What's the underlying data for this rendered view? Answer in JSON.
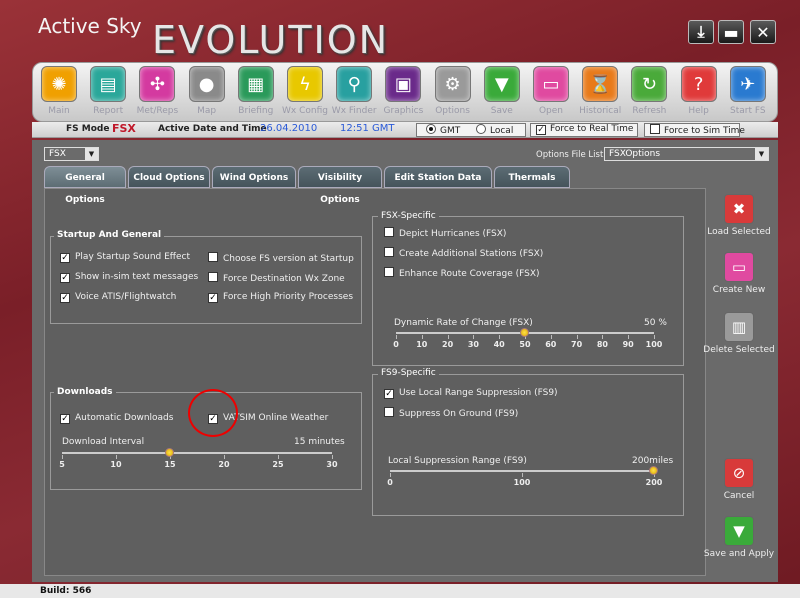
{
  "app": {
    "title_small": "Active Sky",
    "title_big": "EVOLUTION"
  },
  "window_buttons": [
    {
      "glyph": "⤓",
      "name": "download-icon"
    },
    {
      "glyph": "▬",
      "name": "minimize-icon"
    },
    {
      "glyph": "✕",
      "name": "close-icon"
    }
  ],
  "toolbar": [
    {
      "label": "Main",
      "color": "#f0a000",
      "glyph": "✺"
    },
    {
      "label": "Report",
      "color": "#2aa79a",
      "glyph": "▤"
    },
    {
      "label": "Met/Reps",
      "color": "#d43aa0",
      "glyph": "✣"
    },
    {
      "label": "Map",
      "color": "#8a8a8a",
      "glyph": "●"
    },
    {
      "label": "Briefing",
      "color": "#2a9a5a",
      "glyph": "▦"
    },
    {
      "label": "Wx Config",
      "color": "#e8c800",
      "glyph": "ϟ"
    },
    {
      "label": "Wx Finder",
      "color": "#28a0a0",
      "glyph": "⚲"
    },
    {
      "label": "Graphics",
      "color": "#6a2a8a",
      "glyph": "▣"
    },
    {
      "label": "Options",
      "color": "#9a9a9a",
      "glyph": "⚙"
    },
    {
      "label": "Save",
      "color": "#3aaa3a",
      "glyph": "▼"
    },
    {
      "label": "Open",
      "color": "#e04aa0",
      "glyph": "▭"
    },
    {
      "label": "Historical",
      "color": "#e87a1a",
      "glyph": "⌛"
    },
    {
      "label": "Refresh",
      "color": "#4aaa3a",
      "glyph": "↻"
    },
    {
      "label": "Help",
      "color": "#e03a3a",
      "glyph": "?"
    },
    {
      "label": "Start FS",
      "color": "#2a7ad0",
      "glyph": "✈"
    }
  ],
  "modebar": {
    "fs_mode_label": "FS Mode",
    "fs_mode_value": "FSX",
    "date_label": "Active Date and Time",
    "date_value": "26.04.2010",
    "time_value": "12:51 GMT",
    "gmt": "GMT",
    "local": "Local",
    "force_real": "Force to Real Time",
    "force_sim": "Force to Sim Time"
  },
  "fs_select": "FSX",
  "options_file": {
    "label": "Options File List",
    "value": "FSXOptions"
  },
  "tabs": [
    "General Options",
    "Cloud Options",
    "Wind Options",
    "Visibility Options",
    "Edit Station Data",
    "Thermals"
  ],
  "startup": {
    "title": "Startup And General",
    "items": [
      {
        "label": "Play Startup Sound Effect",
        "checked": true
      },
      {
        "label": "Choose FS version at Startup",
        "checked": false
      },
      {
        "label": "Show in-sim text messages",
        "checked": true
      },
      {
        "label": "Force Destination Wx Zone",
        "checked": false
      },
      {
        "label": "Voice ATIS/Flightwatch",
        "checked": true
      },
      {
        "label": "Force High Priority Processes",
        "checked": true
      }
    ]
  },
  "downloads": {
    "title": "Downloads",
    "auto": "Automatic Downloads",
    "vatsim": "VATSIM Online Weather",
    "interval_label": "Download Interval",
    "interval_value": "15 minutes",
    "ticks": [
      "5",
      "10",
      "15",
      "20",
      "25",
      "30"
    ],
    "value": 15,
    "min": 5,
    "max": 30
  },
  "fsx": {
    "title": "FSX-Specific",
    "items": [
      "Depict Hurricanes (FSX)",
      "Create Additional Stations (FSX)",
      "Enhance Route Coverage (FSX)"
    ],
    "rate_label": "Dynamic Rate of Change (FSX)",
    "rate_value": "50 %",
    "ticks": [
      "0",
      "10",
      "20",
      "30",
      "40",
      "50",
      "60",
      "70",
      "80",
      "90",
      "100"
    ],
    "value": 50
  },
  "fs9": {
    "title": "FS9-Specific",
    "items": [
      {
        "label": "Use Local Range Suppression (FS9)",
        "checked": true
      },
      {
        "label": "Suppress On Ground (FS9)",
        "checked": false
      }
    ],
    "range_label": "Local Suppression Range (FS9)",
    "range_value": "200miles",
    "ticks": [
      "0",
      "100",
      "200"
    ],
    "value": 200,
    "max": 200
  },
  "right_buttons": [
    {
      "label": "Load Selected",
      "color": "#d83a3a",
      "glyph": "✖",
      "name": "load-selected-button"
    },
    {
      "label": "Create New",
      "color": "#e04aa0",
      "glyph": "▭",
      "name": "create-new-button"
    },
    {
      "label": "Delete Selected",
      "color": "#9a9a9a",
      "glyph": "▥",
      "name": "delete-selected-button"
    },
    {
      "label": "Cancel",
      "color": "#d83a3a",
      "glyph": "⊘",
      "name": "cancel-button"
    },
    {
      "label": "Save and Apply",
      "color": "#3aaa3a",
      "glyph": "▼",
      "name": "save-apply-button"
    }
  ],
  "status": "Build: 566"
}
